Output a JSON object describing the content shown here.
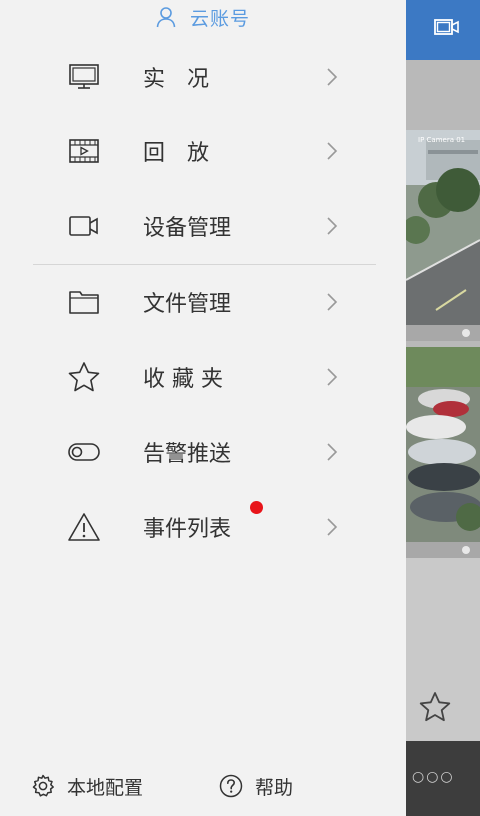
{
  "account": {
    "label": "云账号",
    "color": "#5b9be0"
  },
  "menu": [
    {
      "label": "实　况",
      "icon": "monitor-icon"
    },
    {
      "label": "回　放",
      "icon": "film-playback-icon"
    },
    {
      "label": "设备管理",
      "icon": "video-camera-icon"
    },
    {
      "label": "文件管理",
      "icon": "folder-icon"
    },
    {
      "label": "收 藏 夹",
      "icon": "star-icon"
    },
    {
      "label": "告警推送",
      "icon": "toggle-icon"
    },
    {
      "label": "事件列表",
      "icon": "warning-icon",
      "badge": true,
      "badge_color": "#e8141a"
    }
  ],
  "footer": {
    "settings_label": "本地配置",
    "help_label": "帮助"
  },
  "background": {
    "topbar_color": "#3c79c4",
    "camera_overlay_text": "IP Camera 01",
    "more_dots": "○○○"
  }
}
